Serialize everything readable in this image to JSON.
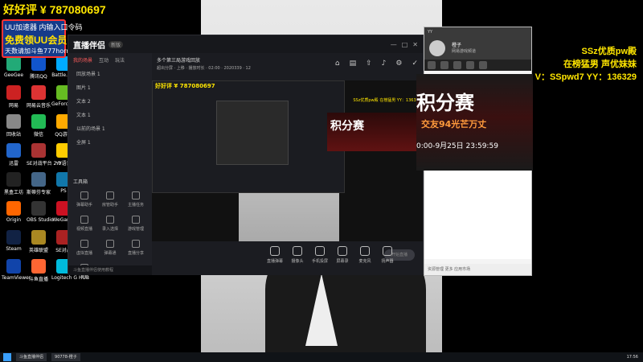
{
  "overlay_top_left": {
    "line1": "好好评 ¥ 787080697",
    "badge": {
      "line1": "UU加速器 内输入口令码",
      "line2": "免费领UU会员",
      "line3": "天数请加斗鱼777horn"
    }
  },
  "overlay_top_right": {
    "line1": "SSz优质pw殿",
    "line2": "在榜猛男 声优妹妹",
    "line3": "V：SSpwd7  YY：136329"
  },
  "desktop_icons": [
    {
      "label": "GeeGee",
      "color": "#2a7"
    },
    {
      "label": "腾讯QQ",
      "color": "#15c"
    },
    {
      "label": "Battle.net",
      "color": "#0af"
    },
    {
      "label": "网易",
      "color": "#c22"
    },
    {
      "label": "网易云音乐",
      "color": "#d33"
    },
    {
      "label": "GeForce Experience",
      "color": "#6b2"
    },
    {
      "label": "回收站",
      "color": "#888"
    },
    {
      "label": "微信",
      "color": "#2b5"
    },
    {
      "label": "QQ游戏",
      "color": "#fa0"
    },
    {
      "label": "迅雷",
      "color": "#26c"
    },
    {
      "label": "SE对战平台 2.0",
      "color": "#a33"
    },
    {
      "label": "YY语音",
      "color": "#fc0"
    },
    {
      "label": "黑盒工坊",
      "color": "#222"
    },
    {
      "label": "斯蒂芬专家",
      "color": "#468"
    },
    {
      "label": "PS",
      "color": "#17a"
    },
    {
      "label": "Origin",
      "color": "#f60"
    },
    {
      "label": "OBS Studio",
      "color": "#333"
    },
    {
      "label": "WeGame",
      "color": "#c12"
    },
    {
      "label": "Steam",
      "color": "#124"
    },
    {
      "label": "英雄联盟",
      "color": "#a82"
    },
    {
      "label": "SE对战",
      "color": "#a22"
    },
    {
      "label": "TeamViewer",
      "color": "#14a"
    },
    {
      "label": "斗鱼直播",
      "color": "#f63"
    },
    {
      "label": "Logitech G HUB",
      "color": "#0bd"
    }
  ],
  "live_app": {
    "logo": "直播伴侣",
    "version": "新版",
    "window_buttons": [
      "—",
      "□",
      "✕"
    ],
    "tabs": [
      "我的场景",
      "互动",
      "玩法"
    ],
    "scenes": [
      "回放场景 1",
      "图片 1",
      "文本 2",
      "文本 1",
      "以前的场景 1",
      "全屏 1"
    ],
    "tools_title": "工具箱",
    "tools": [
      "弹幕助手",
      "房管助手",
      "主播任务",
      "视频直播",
      "录入选择",
      "游戏管理",
      "虚拟直播",
      "弹幕通",
      "直播分享",
      "美颜"
    ],
    "status": "斗鱼直播伴侣使用教程",
    "header_title": "多个第三局游戏回放",
    "header_sub": "超出分屏 · 上移 · 播放时长 · 02:00 · 2020339 · 12",
    "header_icons": [
      "⌂",
      "▤",
      "⇧",
      "♪",
      "⚙",
      "✓"
    ],
    "controls": [
      "直播弹幕",
      "摄像头",
      "手机投屏",
      "屏幕录",
      "麦克风",
      "扬声器"
    ],
    "go_live": "开始直播",
    "preview": {
      "overlay_text": "好好评 ¥ 787080697",
      "red_text": "积分赛",
      "right_text": "SSz优质pw殿 在榜猛男 YY：136329"
    }
  },
  "chat_window": {
    "title": "YY",
    "name": "橙子",
    "subtitle": "网易游戏频道",
    "banner_title": "积分赛",
    "banner_sub": "交友94光芒万丈",
    "banner_time": "0:00-9月25日 23:59:59",
    "bottom": "资源管理  更多  应用市场"
  },
  "taskbar": {
    "items": [
      "斗鱼直播伴侣",
      "90778-橙子"
    ],
    "clock": "17:56"
  }
}
